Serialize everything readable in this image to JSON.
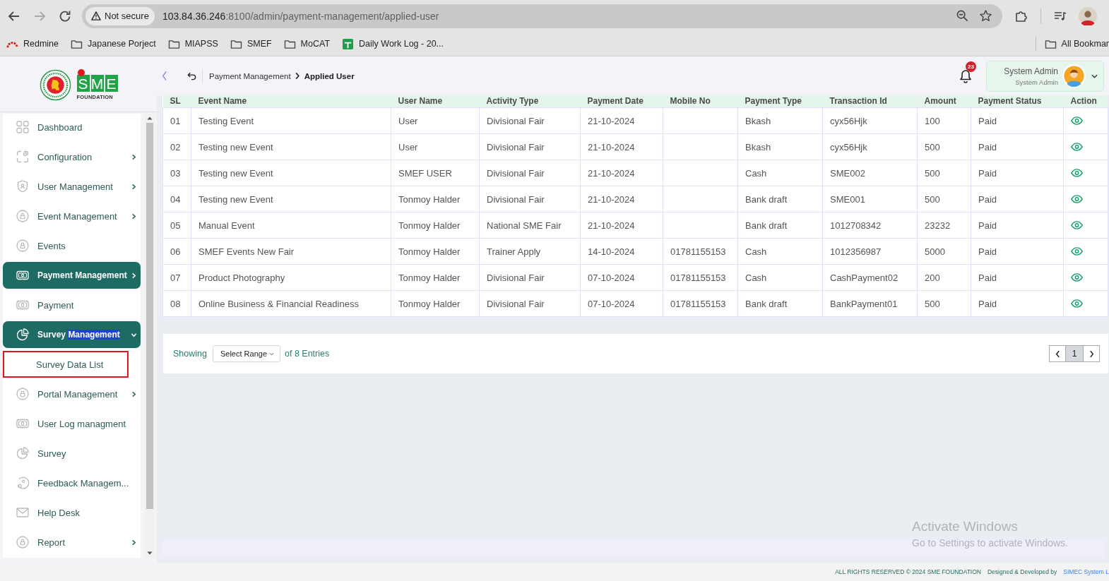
{
  "browser": {
    "nav": [
      {
        "kind": "back",
        "disabled": false
      },
      {
        "kind": "forward",
        "disabled": true
      },
      {
        "kind": "reload",
        "disabled": false
      }
    ],
    "security_chip": "Not secure",
    "url_host": "103.84.36.246",
    "url_rest": ":8100/admin/payment-management/applied-user",
    "bookmarks": [
      {
        "kind": "redmine",
        "label": "Redmine"
      },
      {
        "kind": "folder",
        "label": "Japanese Porject"
      },
      {
        "kind": "folder",
        "label": "MIAPSS"
      },
      {
        "kind": "folder",
        "label": "SMEF"
      },
      {
        "kind": "folder",
        "label": "MoCAT"
      },
      {
        "kind": "sheet",
        "label": "Daily Work Log - 20..."
      }
    ],
    "all_bookmarks": "All Bookmar"
  },
  "sidebar": {
    "logo": {
      "wordmark": "SME",
      "subtitle": "FOUNDATION"
    },
    "items": [
      {
        "label": "Dashboard",
        "selected": false
      },
      {
        "label": "Configuration",
        "selected": false,
        "expanded": false
      },
      {
        "label": "User Management",
        "selected": false,
        "expanded": false
      },
      {
        "label": "Event Management",
        "selected": false,
        "expanded": false
      },
      {
        "label": "Events",
        "selected": false
      },
      {
        "label": "Payment Management",
        "selected": true,
        "expanded": false
      },
      {
        "label": "Payment",
        "selected": false
      },
      {
        "label": "Survey",
        "selected_text": "Management",
        "selected": true,
        "expanded": true,
        "children": [
          {
            "label": "Survey Data List",
            "selected": false,
            "outlined": true
          }
        ]
      },
      {
        "label": "Portal Management",
        "selected": false,
        "expanded": false
      },
      {
        "label": "User Log managment",
        "selected": false
      },
      {
        "label": "Survey",
        "selected": false
      },
      {
        "label": "Feedback Managem...",
        "selected": false
      },
      {
        "label": "Help Desk",
        "selected": false
      },
      {
        "label": "Report",
        "selected": false,
        "expanded": false
      }
    ]
  },
  "header": {
    "breadcrumb": [
      {
        "label": "Payment Management",
        "current": false
      },
      {
        "label": "Applied User",
        "current": true
      }
    ],
    "notification_count": "23",
    "user": {
      "name": "System Admin",
      "role": "System Admin"
    }
  },
  "table": {
    "columns": [
      "SL",
      "Event Name",
      "User Name",
      "Activity Type",
      "Payment Date",
      "Mobile No",
      "Payment Type",
      "Transaction Id",
      "Amount",
      "Payment Status",
      "Action"
    ],
    "rows": [
      {
        "sl": "01",
        "event_name": "Testing Event",
        "user_name": "User",
        "activity_type": "Divisional Fair",
        "payment_date": "21-10-2024",
        "payment_type": "Bkash",
        "transaction_id": "cyx56Hjk",
        "amount": "100",
        "payment_status": "Paid"
      },
      {
        "sl": "02",
        "event_name": "Testing new Event",
        "user_name": "User",
        "activity_type": "Divisional Fair",
        "payment_date": "21-10-2024",
        "payment_type": "Bkash",
        "transaction_id": "cyx56Hjk",
        "amount": "500",
        "payment_status": "Paid"
      },
      {
        "sl": "03",
        "event_name": "Testing new Event",
        "user_name": "SMEF USER",
        "activity_type": "Divisional Fair",
        "payment_date": "21-10-2024",
        "payment_type": "Cash",
        "transaction_id": "SME002",
        "amount": "500",
        "payment_status": "Paid"
      },
      {
        "sl": "04",
        "event_name": "Testing new Event",
        "user_name": "Tonmoy Halder",
        "activity_type": "Divisional Fair",
        "payment_date": "21-10-2024",
        "payment_type": "Bank draft",
        "transaction_id": "SME001",
        "amount": "500",
        "payment_status": "Paid"
      },
      {
        "sl": "05",
        "event_name": "Manual Event",
        "user_name": "Tonmoy Halder",
        "activity_type": "National SME Fair",
        "payment_date": "21-10-2024",
        "payment_type": "Bank draft",
        "transaction_id": "1012708342",
        "amount": "23232",
        "payment_status": "Paid"
      },
      {
        "sl": "06",
        "event_name": "SMEF Events New Fair",
        "user_name": "Tonmoy Halder",
        "activity_type": "Trainer Apply",
        "payment_date": "14-10-2024",
        "mobile_no": "01781155153",
        "payment_type": "Cash",
        "transaction_id": "1012356987",
        "amount": "5000",
        "payment_status": "Paid"
      },
      {
        "sl": "07",
        "event_name": "Product Photography",
        "user_name": "Tonmoy Halder",
        "activity_type": "Divisional Fair",
        "payment_date": "07-10-2024",
        "mobile_no": "01781155153",
        "payment_type": "Cash",
        "transaction_id": "CashPayment02",
        "amount": "200",
        "payment_status": "Paid"
      },
      {
        "sl": "08",
        "event_name": "Online Business & Financial Readiness",
        "user_name": "Tonmoy Halder",
        "activity_type": "Divisional Fair",
        "payment_date": "07-10-2024",
        "mobile_no": "01781155153",
        "payment_type": "Bank draft",
        "transaction_id": "BankPayment01",
        "amount": "500",
        "payment_status": "Paid"
      }
    ]
  },
  "pagination": {
    "label": "Showing",
    "range_select": "Select Range",
    "entries": "of 8 Entries",
    "pages": [
      {
        "label": "1",
        "selected": true
      }
    ]
  },
  "footer": {
    "rights": "ALL RIGHTS RESERVED © 2024 SME FOUNDATION",
    "credit": "Designed & Developed by",
    "developer": "SIMEC System L"
  },
  "os_notice": {
    "title": "Activate Windows",
    "text": "Go to Settings to activate Windows."
  }
}
